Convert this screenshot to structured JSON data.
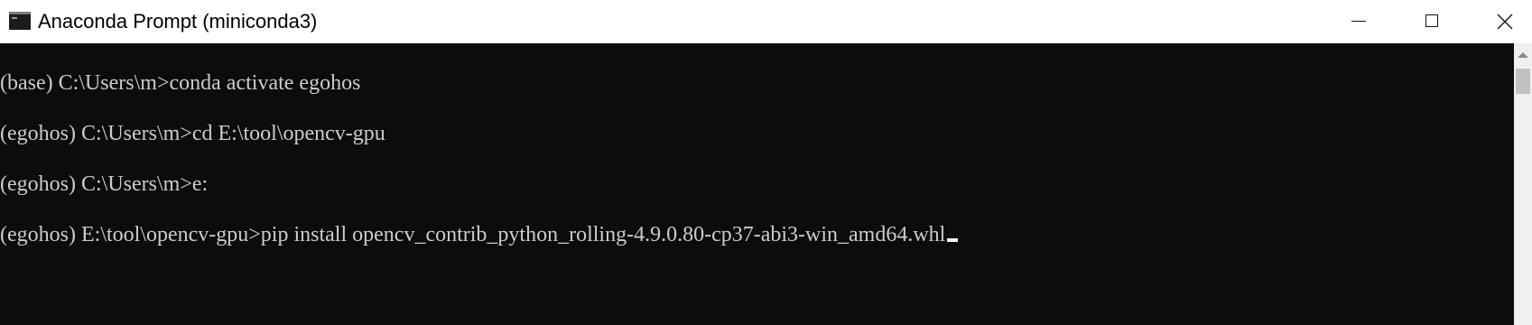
{
  "window": {
    "title": "Anaconda Prompt (miniconda3)",
    "icon": "terminal-icon",
    "controls": {
      "minimize_icon": "minimize-icon",
      "maximize_icon": "maximize-icon",
      "close_icon": "close-icon"
    }
  },
  "console": {
    "lines": [
      "(base) C:\\Users\\m>conda activate egohos",
      "(egohos) C:\\Users\\m>cd E:\\tool\\opencv-gpu",
      "(egohos) C:\\Users\\m>e:",
      "(egohos) E:\\tool\\opencv-gpu>pip install opencv_contrib_python_rolling-4.9.0.80-cp37-abi3-win_amd64.whl"
    ]
  },
  "colors": {
    "background": "#0c0c0c",
    "foreground": "#cccccc",
    "titlebar": "#ffffff"
  }
}
